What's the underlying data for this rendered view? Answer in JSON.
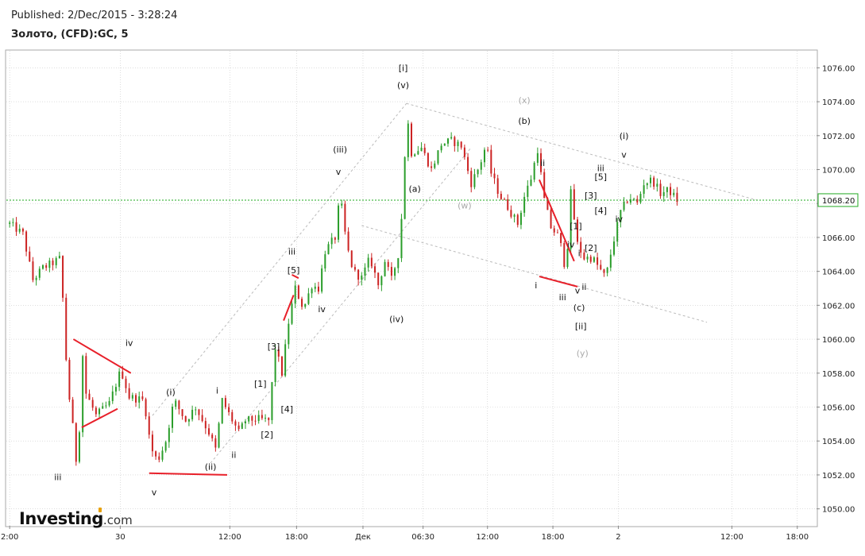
{
  "header": {
    "published": "Published: 2/Dec/2015 - 3:28:24",
    "instrument": "Золото, (CFD):GC, 5"
  },
  "logo": {
    "brand": "Investing",
    "suffix": ".com",
    "accent_color": "#e8a000"
  },
  "chart_data": {
    "type": "candlestick",
    "title": "",
    "xlabel": "",
    "ylabel": "",
    "ylim": [
      1049,
      1077
    ],
    "y_ticks": [
      1050,
      1052,
      1054,
      1056,
      1058,
      1060,
      1062,
      1064,
      1066,
      1068,
      1070,
      1072,
      1074,
      1076
    ],
    "y_tick_labels": [
      "1050.00",
      "1052.00",
      "1054.00",
      "1056.00",
      "1058.00",
      "1060.00",
      "1062.00",
      "1064.00",
      "1066.00",
      "1068.00",
      "1070.00",
      "1072.00",
      "1074.00",
      "1076.00"
    ],
    "x_ticks": [
      {
        "label": "2:00",
        "t": 0
      },
      {
        "label": "30",
        "t": 33.3
      },
      {
        "label": "12:00",
        "t": 66.3
      },
      {
        "label": "18:00",
        "t": 86.4
      },
      {
        "label": "Дек",
        "t": 106.4
      },
      {
        "label": "06:30",
        "t": 124.5
      },
      {
        "label": "12:00",
        "t": 143.9
      },
      {
        "label": "18:00",
        "t": 163.6
      },
      {
        "label": "2",
        "t": 183.3
      },
      {
        "label": "12:00",
        "t": 217.5
      },
      {
        "label": "18:00",
        "t": 237.2
      }
    ],
    "x_range": [
      -1,
      243
    ],
    "grid": true,
    "current_price": {
      "value": 1068.2,
      "label": "1068.20",
      "color": "#22aa22"
    },
    "up_color": "#2a9d2a",
    "down_color": "#cc2222",
    "trend_color": "#e8202a",
    "channel_color": "#bbbbbb",
    "anchors": [
      {
        "t": 0,
        "p": 1066.8
      },
      {
        "t": 4,
        "p": 1066.2
      },
      {
        "t": 7,
        "p": 1063.5
      },
      {
        "t": 10,
        "p": 1064.2
      },
      {
        "t": 13,
        "p": 1064.5
      },
      {
        "t": 15.5,
        "p": 1064.8
      },
      {
        "t": 16.5,
        "p": 1060.0
      },
      {
        "t": 18,
        "p": 1056.5
      },
      {
        "t": 19.5,
        "p": 1054.0
      },
      {
        "t": 20.5,
        "p": 1051.8
      },
      {
        "t": 21.8,
        "p": 1059.5
      },
      {
        "t": 23,
        "p": 1056.8
      },
      {
        "t": 26,
        "p": 1055.5
      },
      {
        "t": 30,
        "p": 1056.2
      },
      {
        "t": 33.5,
        "p": 1058.2
      },
      {
        "t": 36,
        "p": 1056.6
      },
      {
        "t": 40.5,
        "p": 1056.4
      },
      {
        "t": 42.5,
        "p": 1053.6
      },
      {
        "t": 44.5,
        "p": 1052.8
      },
      {
        "t": 47,
        "p": 1054.0
      },
      {
        "t": 49.5,
        "p": 1056.4
      },
      {
        "t": 53,
        "p": 1055.2
      },
      {
        "t": 56,
        "p": 1056.0
      },
      {
        "t": 60,
        "p": 1054.5
      },
      {
        "t": 62,
        "p": 1053.5
      },
      {
        "t": 64,
        "p": 1056.4
      },
      {
        "t": 66,
        "p": 1055.6
      },
      {
        "t": 69,
        "p": 1054.5
      },
      {
        "t": 71,
        "p": 1055.2
      },
      {
        "t": 74.5,
        "p": 1055.3
      },
      {
        "t": 78,
        "p": 1055.2
      },
      {
        "t": 80,
        "p": 1059.5
      },
      {
        "t": 82,
        "p": 1058.0
      },
      {
        "t": 84,
        "p": 1061.0
      },
      {
        "t": 86,
        "p": 1063.0
      },
      {
        "t": 88.5,
        "p": 1061.8
      },
      {
        "t": 91,
        "p": 1063.2
      },
      {
        "t": 93,
        "p": 1063.0
      },
      {
        "t": 95,
        "p": 1065.2
      },
      {
        "t": 98,
        "p": 1066.0
      },
      {
        "t": 99.5,
        "p": 1068.5
      },
      {
        "t": 101.5,
        "p": 1065.5
      },
      {
        "t": 103.5,
        "p": 1064.0
      },
      {
        "t": 106,
        "p": 1063.6
      },
      {
        "t": 108.5,
        "p": 1064.8
      },
      {
        "t": 111,
        "p": 1063.2
      },
      {
        "t": 113,
        "p": 1064.6
      },
      {
        "t": 115,
        "p": 1063.5
      },
      {
        "t": 117,
        "p": 1065.0
      },
      {
        "t": 118.5,
        "p": 1068.2
      },
      {
        "t": 119.5,
        "p": 1073.5
      },
      {
        "t": 121,
        "p": 1071.0
      },
      {
        "t": 124,
        "p": 1071.3
      },
      {
        "t": 127,
        "p": 1070.0
      },
      {
        "t": 130,
        "p": 1071.5
      },
      {
        "t": 133,
        "p": 1071.7
      },
      {
        "t": 136,
        "p": 1071.4
      },
      {
        "t": 139,
        "p": 1069.2
      },
      {
        "t": 141.5,
        "p": 1070.2
      },
      {
        "t": 143.5,
        "p": 1071.5
      },
      {
        "t": 145,
        "p": 1069.8
      },
      {
        "t": 147.5,
        "p": 1068.5
      },
      {
        "t": 150,
        "p": 1067.8
      },
      {
        "t": 153,
        "p": 1066.8
      },
      {
        "t": 155,
        "p": 1068.4
      },
      {
        "t": 157,
        "p": 1069.5
      },
      {
        "t": 159,
        "p": 1071.2
      },
      {
        "t": 161,
        "p": 1068.2
      },
      {
        "t": 163,
        "p": 1066.6
      },
      {
        "t": 165.5,
        "p": 1066.0
      },
      {
        "t": 167.5,
        "p": 1064.0
      },
      {
        "t": 169,
        "p": 1068.6
      },
      {
        "t": 171,
        "p": 1065.6
      },
      {
        "t": 173,
        "p": 1064.8
      },
      {
        "t": 175.5,
        "p": 1064.8
      },
      {
        "t": 177.5,
        "p": 1064.2
      },
      {
        "t": 179.5,
        "p": 1063.6
      },
      {
        "t": 181.5,
        "p": 1065.5
      },
      {
        "t": 184,
        "p": 1067.5
      },
      {
        "t": 186.5,
        "p": 1068.4
      },
      {
        "t": 189,
        "p": 1068.0
      },
      {
        "t": 191,
        "p": 1069.2
      },
      {
        "t": 193.5,
        "p": 1069.4
      },
      {
        "t": 196,
        "p": 1068.6
      },
      {
        "t": 198.5,
        "p": 1068.8
      },
      {
        "t": 201,
        "p": 1068.2
      }
    ],
    "wave_labels": [
      {
        "text": "iii",
        "t": 14.5,
        "p": 1051.7,
        "color": "#111"
      },
      {
        "text": "iv",
        "t": 36,
        "p": 1059.6,
        "color": "#111"
      },
      {
        "text": "v",
        "t": 43.5,
        "p": 1050.8,
        "color": "#111"
      },
      {
        "text": "(i)",
        "t": 48.5,
        "p": 1056.7,
        "color": "#111"
      },
      {
        "text": "(ii)",
        "t": 60.5,
        "p": 1052.3,
        "color": "#111"
      },
      {
        "text": "i",
        "t": 62.5,
        "p": 1056.8,
        "color": "#111"
      },
      {
        "text": "ii",
        "t": 67.5,
        "p": 1053.0,
        "color": "#111"
      },
      {
        "text": "[2]",
        "t": 77.5,
        "p": 1054.2,
        "color": "#111"
      },
      {
        "text": "[1]",
        "t": 75.5,
        "p": 1057.2,
        "color": "#111"
      },
      {
        "text": "[4]",
        "t": 83.5,
        "p": 1055.7,
        "color": "#111"
      },
      {
        "text": "[3]",
        "t": 79.5,
        "p": 1059.4,
        "color": "#111"
      },
      {
        "text": "[5]",
        "t": 85.5,
        "p": 1063.9,
        "color": "#111"
      },
      {
        "text": "iii",
        "t": 85,
        "p": 1065.0,
        "color": "#111"
      },
      {
        "text": "iv",
        "t": 94,
        "p": 1061.6,
        "color": "#111"
      },
      {
        "text": "v",
        "t": 99,
        "p": 1069.7,
        "color": "#111"
      },
      {
        "text": "(iii)",
        "t": 99.5,
        "p": 1071.0,
        "color": "#111"
      },
      {
        "text": "(iv)",
        "t": 116.5,
        "p": 1061.0,
        "color": "#111"
      },
      {
        "text": "[i]",
        "t": 118.5,
        "p": 1075.8,
        "color": "#111"
      },
      {
        "text": "(v)",
        "t": 118.5,
        "p": 1074.8,
        "color": "#111"
      },
      {
        "text": "(a)",
        "t": 122,
        "p": 1068.7,
        "color": "#111"
      },
      {
        "text": "(x)",
        "t": 155,
        "p": 1073.9,
        "color": "#aaaaaa"
      },
      {
        "text": "(w)",
        "t": 137,
        "p": 1067.7,
        "color": "#aaaaaa"
      },
      {
        "text": "(b)",
        "t": 155,
        "p": 1072.7,
        "color": "#111"
      },
      {
        "text": "ii",
        "t": 160.5,
        "p": 1070.2,
        "color": "#111"
      },
      {
        "text": "i",
        "t": 158.5,
        "p": 1063.0,
        "color": "#111"
      },
      {
        "text": "iv",
        "t": 169,
        "p": 1065.4,
        "color": "#111"
      },
      {
        "text": "iii",
        "t": 166.5,
        "p": 1062.3,
        "color": "#111"
      },
      {
        "text": "v",
        "t": 171,
        "p": 1062.7,
        "color": "#111"
      },
      {
        "text": "ii",
        "t": 173,
        "p": 1062.9,
        "color": "#111"
      },
      {
        "text": "(c)",
        "t": 171.5,
        "p": 1061.7,
        "color": "#111"
      },
      {
        "text": "[ii]",
        "t": 172,
        "p": 1060.6,
        "color": "#111"
      },
      {
        "text": "(y)",
        "t": 172.5,
        "p": 1059.0,
        "color": "#aaaaaa"
      },
      {
        "text": "i",
        "t": 171.5,
        "p": 1064.9,
        "color": "#111"
      },
      {
        "text": "[1]",
        "t": 170.5,
        "p": 1066.5,
        "color": "#111"
      },
      {
        "text": "[2]",
        "t": 175,
        "p": 1065.2,
        "color": "#111"
      },
      {
        "text": "[3]",
        "t": 175,
        "p": 1068.3,
        "color": "#111"
      },
      {
        "text": "[4]",
        "t": 178,
        "p": 1067.4,
        "color": "#111"
      },
      {
        "text": "[5]",
        "t": 178,
        "p": 1069.4,
        "color": "#111"
      },
      {
        "text": "iii",
        "t": 178,
        "p": 1069.9,
        "color": "#111"
      },
      {
        "text": "iv",
        "t": 183.5,
        "p": 1066.9,
        "color": "#111"
      },
      {
        "text": "v",
        "t": 185,
        "p": 1070.7,
        "color": "#111"
      },
      {
        "text": "(i)",
        "t": 185,
        "p": 1071.8,
        "color": "#111"
      }
    ],
    "trend_lines": [
      {
        "from": [
          19.2,
          1060.0
        ],
        "to": [
          36.5,
          1058.0
        ]
      },
      {
        "from": [
          21.7,
          1054.8
        ],
        "to": [
          32.5,
          1055.9
        ]
      },
      {
        "from": [
          42,
          1052.1
        ],
        "to": [
          65.5,
          1052.0
        ]
      },
      {
        "from": [
          82.5,
          1061.1
        ],
        "to": [
          85.5,
          1062.6
        ]
      },
      {
        "from": [
          85,
          1063.8
        ],
        "to": [
          87,
          1063.6
        ]
      },
      {
        "from": [
          159.5,
          1069.4
        ],
        "to": [
          170,
          1064.6
        ]
      },
      {
        "from": [
          159.5,
          1063.7
        ],
        "to": [
          171,
          1063.1
        ]
      }
    ],
    "channel_lines": [
      {
        "from": [
          43,
          1055.5
        ],
        "to": [
          119.5,
          1073.9
        ]
      },
      {
        "from": [
          60.5,
          1052.7
        ],
        "to": [
          139,
          1071.3
        ]
      },
      {
        "from": [
          119.5,
          1073.9
        ],
        "to": [
          225,
          1068.2
        ]
      },
      {
        "from": [
          106,
          1066.7
        ],
        "to": [
          210,
          1061.0
        ]
      }
    ]
  }
}
